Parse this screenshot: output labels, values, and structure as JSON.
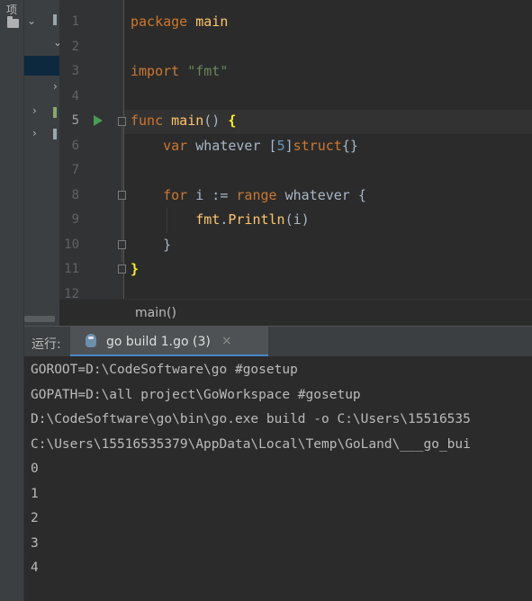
{
  "left_strip": {
    "vertical_label": "项",
    "icon": "folder-icon"
  },
  "tree": {
    "arrows": [
      "⌄",
      "⌄",
      "›",
      "›",
      "›"
    ]
  },
  "editor": {
    "line_numbers": [
      "1",
      "2",
      "3",
      "4",
      "5",
      "6",
      "7",
      "8",
      "9",
      "10",
      "11",
      "12"
    ],
    "current_line": "5",
    "code": {
      "l1_kw": "package",
      "l1_name": " main",
      "l3_kw": "import",
      "l3_str": " \"fmt\"",
      "l5_kw": "func",
      "l5_fn": " main",
      "l5_parens": "() ",
      "l5_brace": "{",
      "l6_indent": "    ",
      "l6_kw": "var",
      "l6_a": " whatever [",
      "l6_num": "5",
      "l6_b": "]",
      "l6_kw2": "struct",
      "l6_c": "{}",
      "l8_indent": "    ",
      "l8_kw": "for",
      "l8_a": " i := ",
      "l8_kw2": "range",
      "l8_b": " whatever {",
      "l9_indent": "        ",
      "l9_pkg": "fmt",
      "l9_a": ".",
      "l9_fn": "Println",
      "l9_b": "(i)",
      "l10_indent": "    ",
      "l10_a": "}",
      "l11_brace": "}"
    }
  },
  "breadcrumb": {
    "label": "main()"
  },
  "run_panel": {
    "label": "运行:",
    "tab": {
      "title": "go build 1.go (3)",
      "close": "×",
      "icon": "gopher-icon"
    },
    "console_lines": [
      "GOROOT=D:\\CodeSoftware\\go #gosetup",
      "GOPATH=D:\\all project\\GoWorkspace #gosetup",
      "D:\\CodeSoftware\\go\\bin\\go.exe build -o C:\\Users\\15516535",
      "C:\\Users\\15516535379\\AppData\\Local\\Temp\\GoLand\\___go_bui",
      "0",
      "1",
      "2",
      "3",
      "4"
    ]
  },
  "colors": {
    "keyword": "#cc7832",
    "function": "#ffc66d",
    "string": "#6a8759",
    "number": "#6897bb",
    "run_green": "#499c54",
    "tab_underline": "#4a88c7"
  }
}
